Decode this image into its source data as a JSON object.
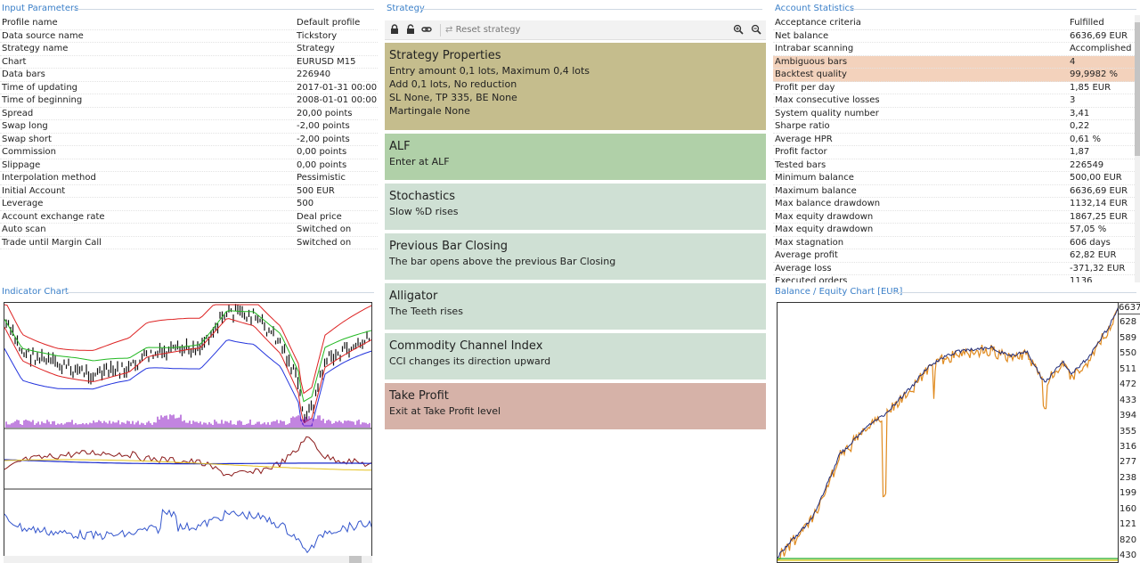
{
  "input_parameters": {
    "title": "Input Parameters",
    "rows": [
      {
        "label": "Profile name",
        "value": "Default profile"
      },
      {
        "label": "Data source name",
        "value": "Tickstory"
      },
      {
        "label": "Strategy name",
        "value": "Strategy"
      },
      {
        "label": "Chart",
        "value": "EURUSD M15"
      },
      {
        "label": "Data bars",
        "value": "226940"
      },
      {
        "label": "Time of updating",
        "value": "2017-01-31 00:00"
      },
      {
        "label": "Time of beginning",
        "value": "2008-01-01 00:00"
      },
      {
        "label": "Spread",
        "value": "20,00 points"
      },
      {
        "label": "Swap long",
        "value": "-2,00 points"
      },
      {
        "label": "Swap short",
        "value": "-2,00 points"
      },
      {
        "label": "Commission",
        "value": "0,00 points"
      },
      {
        "label": "Slippage",
        "value": "0,00 points"
      },
      {
        "label": "Interpolation method",
        "value": "Pessimistic"
      },
      {
        "label": "Initial Account",
        "value": "500 EUR"
      },
      {
        "label": "Leverage",
        "value": "500"
      },
      {
        "label": "Account exchange rate",
        "value": "Deal price"
      },
      {
        "label": "Auto scan",
        "value": "Switched on"
      },
      {
        "label": "Trade until Margin Call",
        "value": "Switched on"
      }
    ]
  },
  "strategy": {
    "title": "Strategy",
    "toolbar": {
      "reset_label": "Reset strategy",
      "icons": [
        "lock-icon",
        "unlock-icon",
        "link-icon",
        "reset-icon",
        "zoom-in-icon",
        "zoom-out-icon"
      ]
    },
    "slots": [
      {
        "name": "Strategy Properties",
        "lines": [
          "Entry amount 0,1 lots, Maximum 0,4 lots",
          "Add 0,1 lots, No reduction",
          "SL None,  TP 335,  BE None",
          "Martingale None"
        ],
        "color": "#c5bd8d"
      },
      {
        "name": "ALF",
        "lines": [
          "Enter at ALF"
        ],
        "color": "#b0d0a8"
      },
      {
        "name": "Stochastics",
        "lines": [
          "Slow %D rises"
        ],
        "color": "#cfe0d4"
      },
      {
        "name": "Previous Bar Closing",
        "lines": [
          "The bar opens above the previous Bar Closing"
        ],
        "color": "#cfe0d4"
      },
      {
        "name": "Alligator",
        "lines": [
          "The Teeth rises"
        ],
        "color": "#cfe0d4"
      },
      {
        "name": "Commodity Channel Index",
        "lines": [
          "CCI changes its direction upward"
        ],
        "color": "#cfe0d4"
      },
      {
        "name": "Take Profit",
        "lines": [
          "Exit at Take Profit level"
        ],
        "color": "#d6b2a8"
      }
    ]
  },
  "account_statistics": {
    "title": "Account Statistics",
    "rows": [
      {
        "label": "Acceptance criteria",
        "value": "Fulfilled"
      },
      {
        "label": "Net balance",
        "value": "6636,69 EUR"
      },
      {
        "label": "Intrabar scanning",
        "value": "Accomplished"
      },
      {
        "label": "Ambiguous bars",
        "value": "4",
        "highlight": true
      },
      {
        "label": "Backtest quality",
        "value": "99,9982 %",
        "highlight": true
      },
      {
        "label": "Profit per day",
        "value": "1,85 EUR"
      },
      {
        "label": "Max consecutive losses",
        "value": "3"
      },
      {
        "label": "System quality number",
        "value": "3,41"
      },
      {
        "label": "Sharpe ratio",
        "value": "0,22"
      },
      {
        "label": "Average HPR",
        "value": "0,61 %"
      },
      {
        "label": "Profit factor",
        "value": "1,87"
      },
      {
        "label": "Tested bars",
        "value": "226549"
      },
      {
        "label": "Minimum balance",
        "value": "500,00 EUR"
      },
      {
        "label": "Maximum balance",
        "value": "6636,69 EUR"
      },
      {
        "label": "Max balance drawdown",
        "value": "1132,14 EUR"
      },
      {
        "label": "Max equity drawdown",
        "value": "1867,25 EUR"
      },
      {
        "label": "Max equity drawdown",
        "value": "57,05 %"
      },
      {
        "label": "Max stagnation",
        "value": "606 days"
      },
      {
        "label": "Average profit",
        "value": "62,82 EUR"
      },
      {
        "label": "Average loss",
        "value": "-371,32 EUR"
      },
      {
        "label": "Executed orders",
        "value": "1136"
      }
    ]
  },
  "indicator_chart": {
    "title": "Indicator Chart"
  },
  "equity_chart": {
    "title": "Balance / Equity Chart [EUR]",
    "y_labels": [
      "6637",
      "628",
      "589",
      "550",
      "511",
      "472",
      "433",
      "394",
      "355",
      "316",
      "277",
      "238",
      "199",
      "160",
      "121",
      "820",
      "430"
    ]
  },
  "colors": {
    "title_blue": "#3a7fc8",
    "highlight": "#f3d2bc",
    "balance_line": "#1e2a78",
    "equity_line": "#e08a1e"
  }
}
